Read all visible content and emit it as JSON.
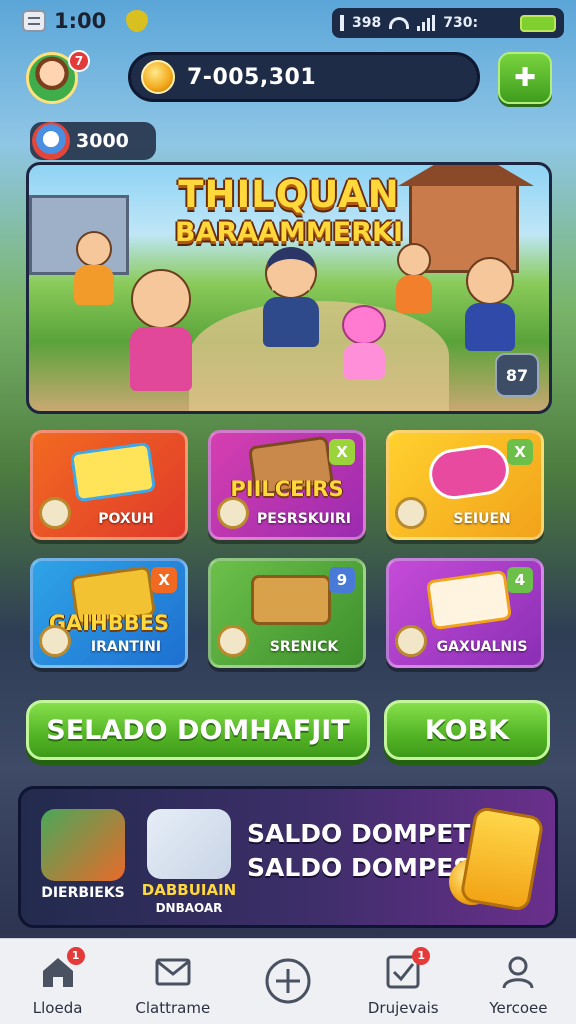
{
  "status_bar": {
    "time_left": "1:00",
    "carrier_text": "398",
    "time_right": "730:"
  },
  "header": {
    "notification_count": "7",
    "coin_balance": "7-005,301",
    "chip_value": "3000"
  },
  "hero": {
    "title_line1": "THILQUAN",
    "title_line2": "BARAAMMERKI",
    "badge": "87"
  },
  "games": [
    {
      "label": "POXUH",
      "corner": "",
      "color_a": "#f26a21",
      "color_b": "#e03a2a"
    },
    {
      "label": "PESRSKUIRI",
      "title": "PIILCEIRS",
      "corner": "X",
      "color_a": "#d63fb0",
      "color_b": "#9b2bb0"
    },
    {
      "label": "SEIUEN",
      "corner": "X",
      "color_a": "#ffd12e",
      "color_b": "#f2a21a"
    },
    {
      "label": "IRANTINI",
      "title": "GAIHBBES",
      "corner": "X",
      "color_a": "#2fa4e7",
      "color_b": "#1e6fd0"
    },
    {
      "label": "SRENICK",
      "corner": "9",
      "color_a": "#6cc04a",
      "color_b": "#3d8f2c"
    },
    {
      "label": "GAXUALNIS",
      "corner": "4",
      "color_a": "#c64bd8",
      "color_b": "#8a2fb5"
    }
  ],
  "actions": {
    "primary_label": "SELADO DOMHAFJIT",
    "secondary_label": "KOBK"
  },
  "promo": {
    "app1_label": "DIERBIEKS",
    "app2_title": "DABBUIAIN",
    "app2_label": "DNBAOAR",
    "text_line1": "SALDO DOMPET",
    "text_line2": "SALDO DOMPES!"
  },
  "bottom_nav": [
    {
      "label": "Lloeda",
      "icon": "home-icon",
      "badge": "1"
    },
    {
      "label": "Clattrame",
      "icon": "mail-icon",
      "badge": ""
    },
    {
      "label": "",
      "icon": "plus-circle-icon",
      "badge": ""
    },
    {
      "label": "Drujevais",
      "icon": "task-check-icon",
      "badge": "1"
    },
    {
      "label": "Yercoee",
      "icon": "profile-icon",
      "badge": ""
    }
  ],
  "colors": {
    "accent_green": "#53b425",
    "dark_panel": "#1f2c48",
    "gold": "#ffd93b"
  }
}
